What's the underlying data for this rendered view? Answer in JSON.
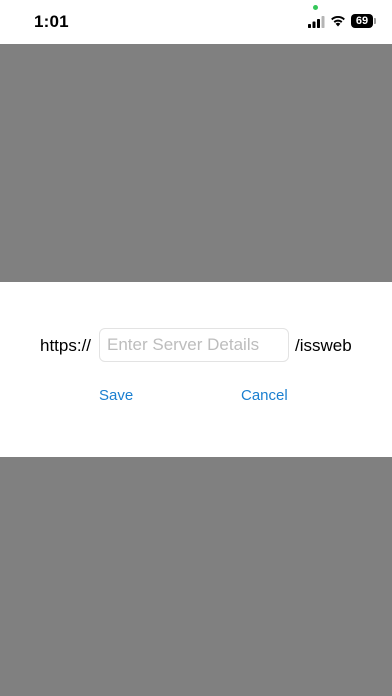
{
  "status_bar": {
    "time": "1:01",
    "battery_level": "69",
    "signal_icon": "cellular-signal-icon",
    "wifi_icon": "wifi-icon",
    "camera_indicator_color": "#34c759"
  },
  "dialog": {
    "prefix": "https://",
    "input": {
      "value": "",
      "placeholder": "Enter Server Details"
    },
    "suffix": "/issweb",
    "save_label": "Save",
    "cancel_label": "Cancel"
  },
  "colors": {
    "overlay": "#808080",
    "accent": "#1a7fd0"
  }
}
